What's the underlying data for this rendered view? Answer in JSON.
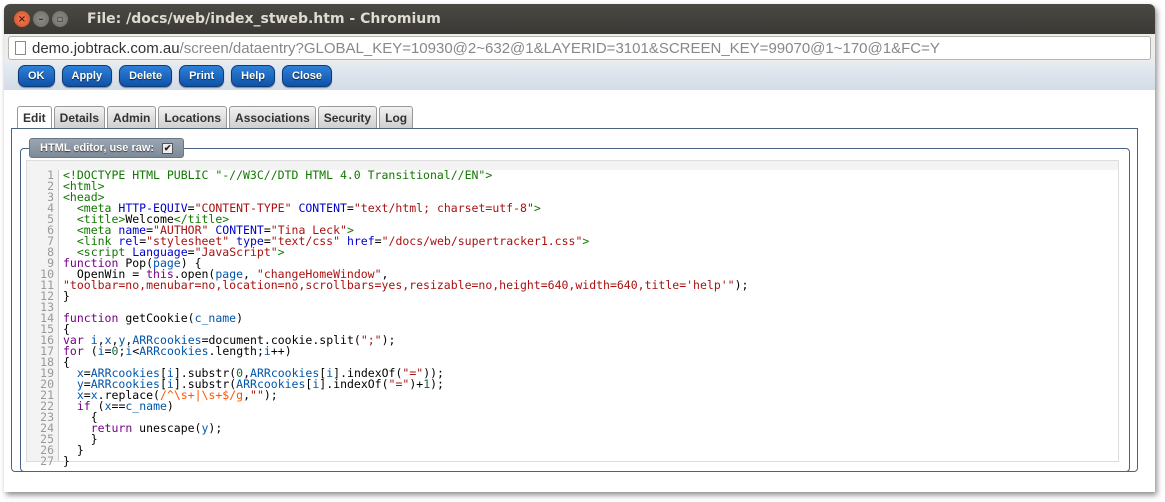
{
  "window": {
    "title": "File: /docs/web/index_stweb.htm - Chromium"
  },
  "url": {
    "host": "demo.jobtrack.com.au",
    "path": "/screen/dataentry?GLOBAL_KEY=10930@2~632@1&LAYERID=3101&SCREEN_KEY=99070@1~170@1&FC=Y"
  },
  "toolbar": [
    "OK",
    "Apply",
    "Delete",
    "Print",
    "Help",
    "Close"
  ],
  "tabs": [
    "Edit",
    "Details",
    "Admin",
    "Locations",
    "Associations",
    "Security",
    "Log"
  ],
  "active_tab": "Edit",
  "editor": {
    "legend": "HTML editor, use raw:",
    "raw_checked": true,
    "lines": [
      [
        [
          "t",
          "<!DOCTYPE HTML PUBLIC \"-//W3C//DTD HTML 4.0 Transitional//EN\">"
        ]
      ],
      [
        [
          "t",
          "<html>"
        ]
      ],
      [
        [
          "t",
          "<head>"
        ]
      ],
      [
        [
          "p",
          "  "
        ],
        [
          "t",
          "<meta "
        ],
        [
          "a",
          "HTTP-EQUIV"
        ],
        [
          "p",
          "="
        ],
        [
          "s",
          "\"CONTENT-TYPE\""
        ],
        [
          "a",
          " CONTENT"
        ],
        [
          "p",
          "="
        ],
        [
          "s",
          "\"text/html; charset=utf-8\""
        ],
        [
          "t",
          ">"
        ]
      ],
      [
        [
          "p",
          "  "
        ],
        [
          "t",
          "<title>"
        ],
        [
          "p",
          "Welcome"
        ],
        [
          "t",
          "</title>"
        ]
      ],
      [
        [
          "p",
          "  "
        ],
        [
          "t",
          "<meta "
        ],
        [
          "a",
          "name"
        ],
        [
          "p",
          "="
        ],
        [
          "s",
          "\"AUTHOR\""
        ],
        [
          "a",
          " CONTENT"
        ],
        [
          "p",
          "="
        ],
        [
          "s",
          "\"Tina Leck\""
        ],
        [
          "t",
          ">"
        ]
      ],
      [
        [
          "p",
          "  "
        ],
        [
          "t",
          "<link "
        ],
        [
          "a",
          "rel"
        ],
        [
          "p",
          "="
        ],
        [
          "s",
          "\"stylesheet\""
        ],
        [
          "a",
          " type"
        ],
        [
          "p",
          "="
        ],
        [
          "s",
          "\"text/css\""
        ],
        [
          "a",
          " href"
        ],
        [
          "p",
          "="
        ],
        [
          "s",
          "\"/docs/web/supertracker1.css\""
        ],
        [
          "t",
          ">"
        ]
      ],
      [
        [
          "p",
          "  "
        ],
        [
          "t",
          "<script "
        ],
        [
          "a",
          "Language"
        ],
        [
          "p",
          "="
        ],
        [
          "s",
          "\"JavaScript\""
        ],
        [
          "t",
          ">"
        ]
      ],
      [
        [
          "k",
          "function "
        ],
        [
          "p",
          "Pop("
        ],
        [
          "v",
          "page"
        ],
        [
          "p",
          ") {"
        ]
      ],
      [
        [
          "p",
          "  OpenWin = "
        ],
        [
          "k",
          "this"
        ],
        [
          "p",
          ".open("
        ],
        [
          "v",
          "page"
        ],
        [
          "p",
          ", "
        ],
        [
          "s",
          "\"changeHomeWindow\""
        ],
        [
          "p",
          ","
        ]
      ],
      [
        [
          "s",
          "\"toolbar=no,menubar=no,location=no,scrollbars=yes,resizable=no,height=640,width=640,title='help'\""
        ],
        [
          "p",
          ");"
        ]
      ],
      [
        [
          "p",
          "}"
        ]
      ],
      [
        [
          "p",
          ""
        ]
      ],
      [
        [
          "k",
          "function "
        ],
        [
          "p",
          "getCookie("
        ],
        [
          "v",
          "c_name"
        ],
        [
          "p",
          ")"
        ]
      ],
      [
        [
          "p",
          "{"
        ]
      ],
      [
        [
          "k",
          "var "
        ],
        [
          "v",
          "i"
        ],
        [
          "p",
          ","
        ],
        [
          "v",
          "x"
        ],
        [
          "p",
          ","
        ],
        [
          "v",
          "y"
        ],
        [
          "p",
          ","
        ],
        [
          "v",
          "ARRcookies"
        ],
        [
          "p",
          "=document.cookie.split("
        ],
        [
          "s",
          "\";\""
        ],
        [
          "p",
          ");"
        ]
      ],
      [
        [
          "k",
          "for "
        ],
        [
          "p",
          "("
        ],
        [
          "v",
          "i"
        ],
        [
          "p",
          "="
        ],
        [
          "n",
          "0"
        ],
        [
          "p",
          ";"
        ],
        [
          "v",
          "i"
        ],
        [
          "p",
          "<"
        ],
        [
          "v",
          "ARRcookies"
        ],
        [
          "p",
          ".length;"
        ],
        [
          "v",
          "i"
        ],
        [
          "p",
          "++)"
        ]
      ],
      [
        [
          "p",
          "{"
        ]
      ],
      [
        [
          "p",
          "  "
        ],
        [
          "v",
          "x"
        ],
        [
          "p",
          "="
        ],
        [
          "v",
          "ARRcookies"
        ],
        [
          "p",
          "["
        ],
        [
          "v",
          "i"
        ],
        [
          "p",
          "].substr("
        ],
        [
          "n",
          "0"
        ],
        [
          "p",
          ","
        ],
        [
          "v",
          "ARRcookies"
        ],
        [
          "p",
          "["
        ],
        [
          "v",
          "i"
        ],
        [
          "p",
          "].indexOf("
        ],
        [
          "s",
          "\"=\""
        ],
        [
          "p",
          "));"
        ]
      ],
      [
        [
          "p",
          "  "
        ],
        [
          "v",
          "y"
        ],
        [
          "p",
          "="
        ],
        [
          "v",
          "ARRcookies"
        ],
        [
          "p",
          "["
        ],
        [
          "v",
          "i"
        ],
        [
          "p",
          "].substr("
        ],
        [
          "v",
          "ARRcookies"
        ],
        [
          "p",
          "["
        ],
        [
          "v",
          "i"
        ],
        [
          "p",
          "].indexOf("
        ],
        [
          "s",
          "\"=\""
        ],
        [
          "p",
          ")+"
        ],
        [
          "n",
          "1"
        ],
        [
          "p",
          ");"
        ]
      ],
      [
        [
          "p",
          "  "
        ],
        [
          "v",
          "x"
        ],
        [
          "p",
          "="
        ],
        [
          "v",
          "x"
        ],
        [
          "p",
          ".replace("
        ],
        [
          "r",
          "/^\\s+|\\s+$/g"
        ],
        [
          "p",
          ","
        ],
        [
          "s",
          "\"\""
        ],
        [
          "p",
          ");"
        ]
      ],
      [
        [
          "p",
          "  "
        ],
        [
          "k",
          "if "
        ],
        [
          "p",
          "("
        ],
        [
          "v",
          "x"
        ],
        [
          "p",
          "=="
        ],
        [
          "v",
          "c_name"
        ],
        [
          "p",
          ")"
        ]
      ],
      [
        [
          "p",
          "    {"
        ]
      ],
      [
        [
          "p",
          "    "
        ],
        [
          "k",
          "return "
        ],
        [
          "p",
          "unescape("
        ],
        [
          "v",
          "y"
        ],
        [
          "p",
          ");"
        ]
      ],
      [
        [
          "p",
          "    }"
        ]
      ],
      [
        [
          "p",
          "  }"
        ]
      ],
      [
        [
          "p",
          "}"
        ]
      ]
    ]
  }
}
